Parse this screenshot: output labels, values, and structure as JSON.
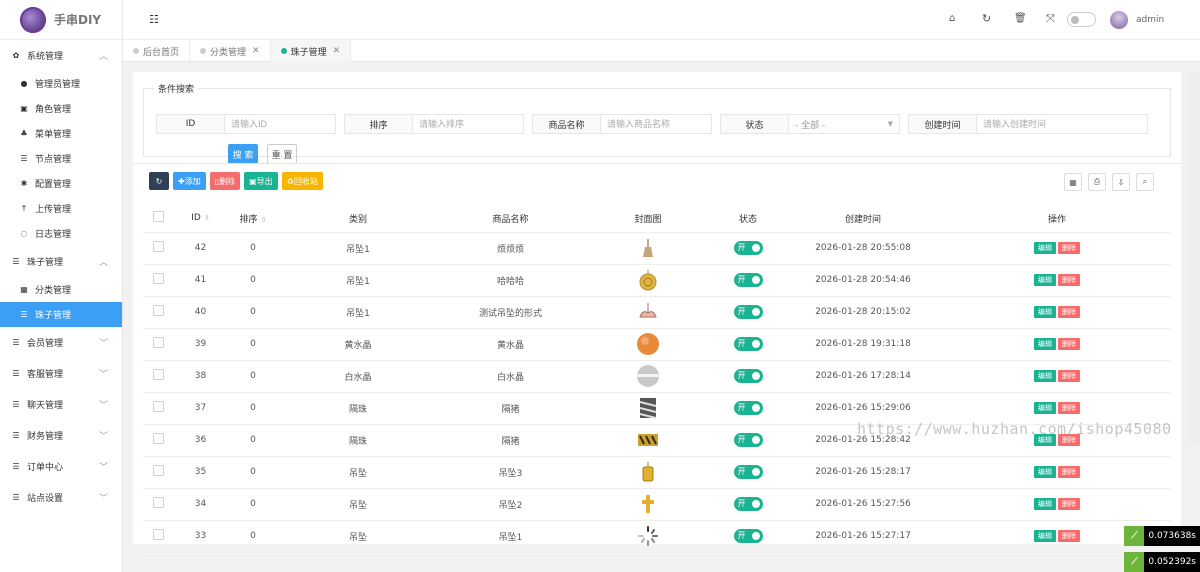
{
  "app": {
    "title": "手串DIY",
    "user": "admin"
  },
  "sidebar": {
    "groups": [
      {
        "label": "系统管理",
        "icon": "gear-icon",
        "expanded": true,
        "items": [
          {
            "label": "管理员管理",
            "icon": "user-icon"
          },
          {
            "label": "角色管理",
            "icon": "role-icon"
          },
          {
            "label": "菜单管理",
            "icon": "tree-icon"
          },
          {
            "label": "节点管理",
            "icon": "list-icon"
          },
          {
            "label": "配置管理",
            "icon": "asterisk-icon"
          },
          {
            "label": "上传管理",
            "icon": "upload-icon"
          },
          {
            "label": "日志管理",
            "icon": "log-icon"
          }
        ]
      },
      {
        "label": "珠子管理",
        "icon": "list-icon",
        "expanded": true,
        "items": [
          {
            "label": "分类管理",
            "icon": "calendar-icon"
          },
          {
            "label": "珠子管理",
            "icon": "list-icon",
            "active": true
          }
        ]
      },
      {
        "label": "会员管理",
        "icon": "list-icon"
      },
      {
        "label": "客服管理",
        "icon": "list-icon"
      },
      {
        "label": "聊天管理",
        "icon": "list-icon"
      },
      {
        "label": "财务管理",
        "icon": "list-icon"
      },
      {
        "label": "订单中心",
        "icon": "list-icon"
      },
      {
        "label": "站点设置",
        "icon": "list-icon"
      }
    ]
  },
  "tabs": [
    {
      "label": "后台首页"
    },
    {
      "label": "分类管理"
    },
    {
      "label": "珠子管理",
      "active": true
    }
  ],
  "search": {
    "legend": "条件搜索",
    "fields": [
      {
        "label": "ID",
        "placeholder": "请输入ID"
      },
      {
        "label": "排序",
        "placeholder": "请输入排序"
      },
      {
        "label": "商品名称",
        "placeholder": "请输入商品名称"
      },
      {
        "label": "状态",
        "value": "- 全部 -"
      },
      {
        "label": "创建时间",
        "placeholder": "请输入创建时间"
      }
    ],
    "search_btn": "搜 索",
    "reset_btn": "重 置"
  },
  "toolbar": {
    "add": "添加",
    "delete": "删除",
    "export": "导出",
    "recycle": "回收站"
  },
  "table": {
    "headers": [
      "ID",
      "排序",
      "类别",
      "商品名称",
      "封面图",
      "状态",
      "创建时间",
      "操作"
    ],
    "switch_on": "开",
    "edit": "编辑",
    "del": "删除",
    "rows": [
      {
        "id": "42",
        "sort": "0",
        "cat": "吊坠1",
        "name": "烦烦烦",
        "time": "2026-01-28 20:55:08",
        "thumb": "tassel"
      },
      {
        "id": "41",
        "sort": "0",
        "cat": "吊坠1",
        "name": "哈哈哈",
        "time": "2026-01-28 20:54:46",
        "thumb": "gold-disc"
      },
      {
        "id": "40",
        "sort": "0",
        "cat": "吊坠1",
        "name": "测试吊坠的形式",
        "time": "2026-01-28 20:15:02",
        "thumb": "bow"
      },
      {
        "id": "39",
        "sort": "0",
        "cat": "黄水晶",
        "name": "黄水晶",
        "time": "2026-01-28 19:31:18",
        "thumb": "orange-bead"
      },
      {
        "id": "38",
        "sort": "0",
        "cat": "白水晶",
        "name": "白水晶",
        "time": "2026-01-26 17:28:14",
        "thumb": "white-bead"
      },
      {
        "id": "37",
        "sort": "0",
        "cat": "隔珠",
        "name": "隔猪",
        "time": "2026-01-26 15:29:06",
        "thumb": "silver-spacer"
      },
      {
        "id": "36",
        "sort": "0",
        "cat": "隔珠",
        "name": "隔猪",
        "time": "2026-01-26 15:28:42",
        "thumb": "gold-spacer"
      },
      {
        "id": "35",
        "sort": "0",
        "cat": "吊坠",
        "name": "吊坠3",
        "time": "2026-01-26 15:28:17",
        "thumb": "gold-charm"
      },
      {
        "id": "34",
        "sort": "0",
        "cat": "吊坠",
        "name": "吊坠2",
        "time": "2026-01-26 15:27:56",
        "thumb": "gold-cross"
      },
      {
        "id": "33",
        "sort": "0",
        "cat": "吊坠",
        "name": "吊坠1",
        "time": "2026-01-26 15:27:17",
        "thumb": "loading"
      }
    ]
  },
  "watermark": "https://www.huzhan.com/ishop45080",
  "perf": [
    "0.073638s",
    "0.052392s"
  ],
  "colors": {
    "accent": "#3a9ff5",
    "green": "#1ab394",
    "red": "#f56c6c",
    "yellow": "#f7b500",
    "dark": "#2f4056"
  }
}
